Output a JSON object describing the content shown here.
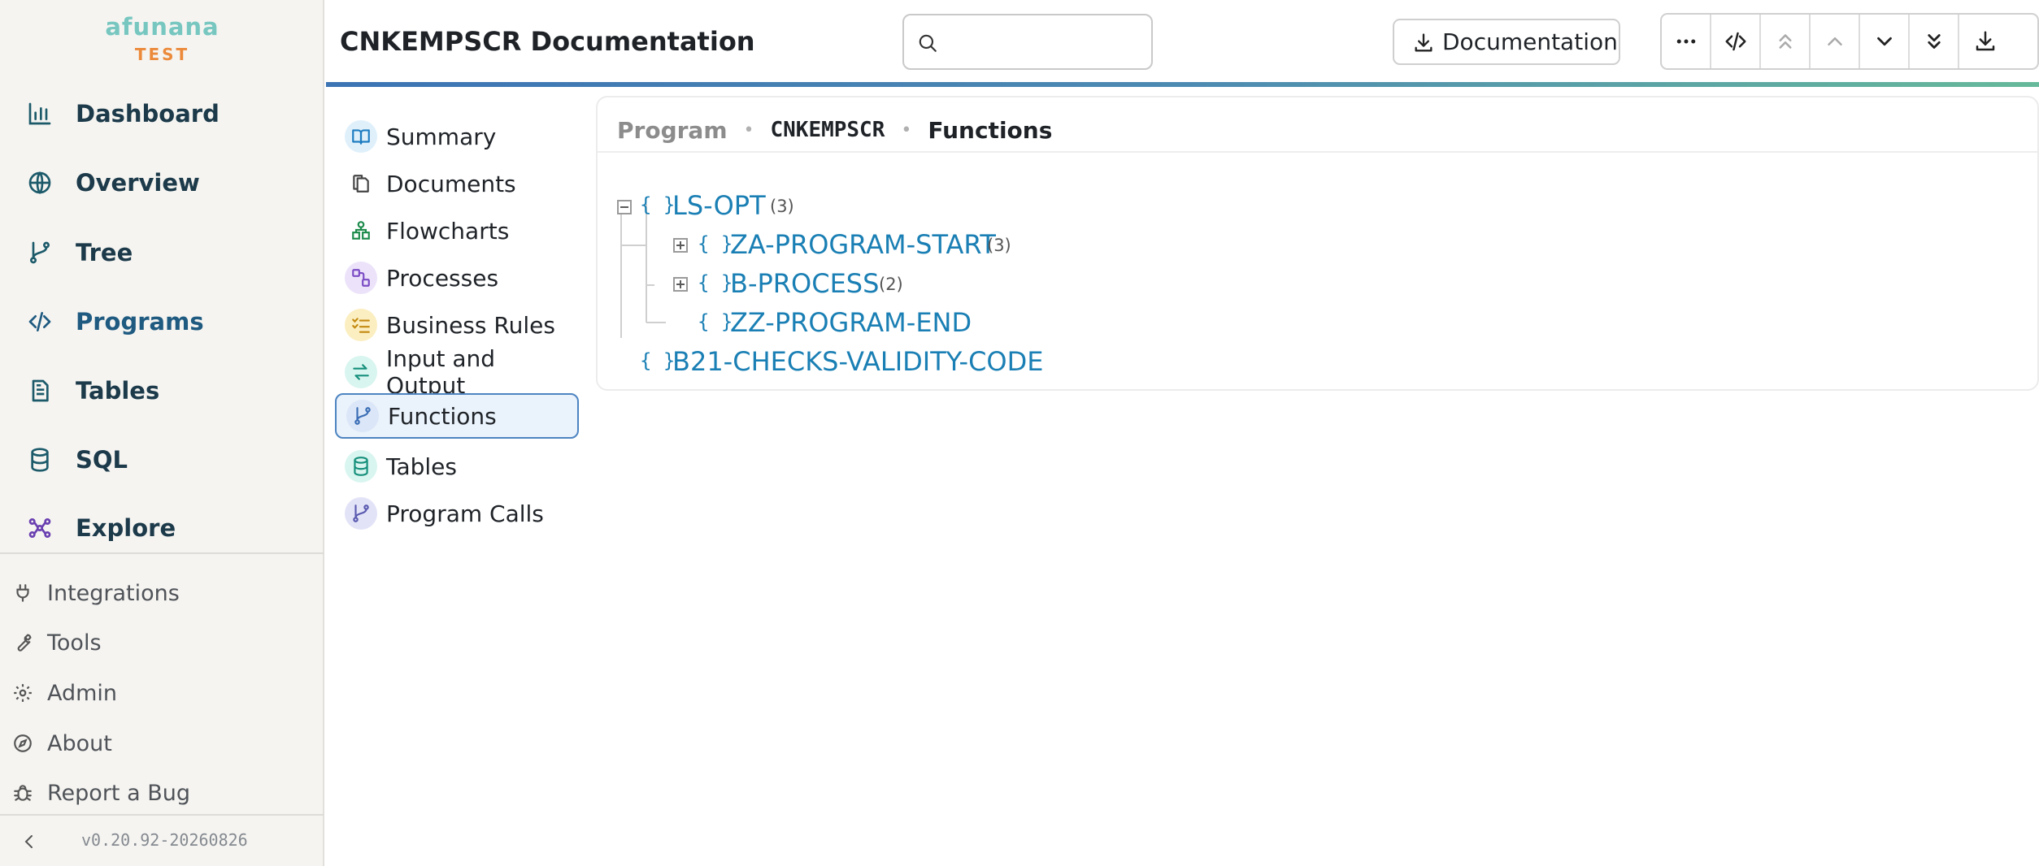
{
  "brand": {
    "name": "afunana",
    "environment": "TEST"
  },
  "nav": {
    "main": [
      {
        "label": "Dashboard",
        "icon": "chart-bar-icon"
      },
      {
        "label": "Overview",
        "icon": "globe-icon"
      },
      {
        "label": "Tree",
        "icon": "branch-icon"
      },
      {
        "label": "Programs",
        "icon": "code-icon",
        "active": true
      },
      {
        "label": "Tables",
        "icon": "document-icon"
      },
      {
        "label": "SQL",
        "icon": "database-icon"
      },
      {
        "label": "Explore",
        "icon": "network-icon"
      }
    ],
    "secondary": [
      {
        "label": "Integrations",
        "icon": "plug-icon"
      },
      {
        "label": "Tools",
        "icon": "wrench-icon"
      },
      {
        "label": "Admin",
        "icon": "gear-icon"
      },
      {
        "label": "About",
        "icon": "compass-icon"
      },
      {
        "label": "Report a Bug",
        "icon": "bug-icon"
      }
    ],
    "version": "v0.20.92-20260826"
  },
  "header": {
    "title": "CNKEMPSCR Documentation",
    "search": {
      "value": "",
      "placeholder": ""
    },
    "documentation_button": "Documentation",
    "toolbar": [
      "more-icon",
      "code-icon",
      "chevrons-up-icon",
      "chevron-up-icon",
      "chevron-down-icon",
      "chevrons-down-icon",
      "download-icon"
    ]
  },
  "subnav": {
    "items": [
      {
        "label": "Summary",
        "icon": "book-icon"
      },
      {
        "label": "Documents",
        "icon": "copy-icon"
      },
      {
        "label": "Flowcharts",
        "icon": "flowchart-icon"
      },
      {
        "label": "Processes",
        "icon": "process-icon"
      },
      {
        "label": "Business Rules",
        "icon": "checklist-icon"
      },
      {
        "label": "Input and Output",
        "icon": "arrows-icon"
      },
      {
        "label": "Functions",
        "icon": "function-icon",
        "active": true
      },
      {
        "label": "Tables",
        "icon": "database-icon"
      },
      {
        "label": "Program Calls",
        "icon": "branch-icon"
      }
    ]
  },
  "breadcrumb": {
    "root": "Program",
    "program": "CNKEMPSCR",
    "current": "Functions"
  },
  "tree": {
    "braces": "{}",
    "nodes": [
      {
        "label": "LS-OPT",
        "count": "(3)",
        "expanded": true
      },
      {
        "label": "ZA-PROGRAM-START",
        "count": "(3)",
        "expanded": false
      },
      {
        "label": "B-PROCESS",
        "count": "(2)",
        "expanded": false
      },
      {
        "label": "ZZ-PROGRAM-END"
      },
      {
        "label": "B21-CHECKS-VALIDITY-CODE"
      }
    ]
  },
  "colors": {
    "accent": "#1f5a80",
    "link": "#1a7fb4",
    "brand_name": "#77c7c0",
    "brand_env": "#ec8a3b",
    "sidebar_bg": "#f5f4f1",
    "active_subnav_border": "#4d84c1"
  }
}
